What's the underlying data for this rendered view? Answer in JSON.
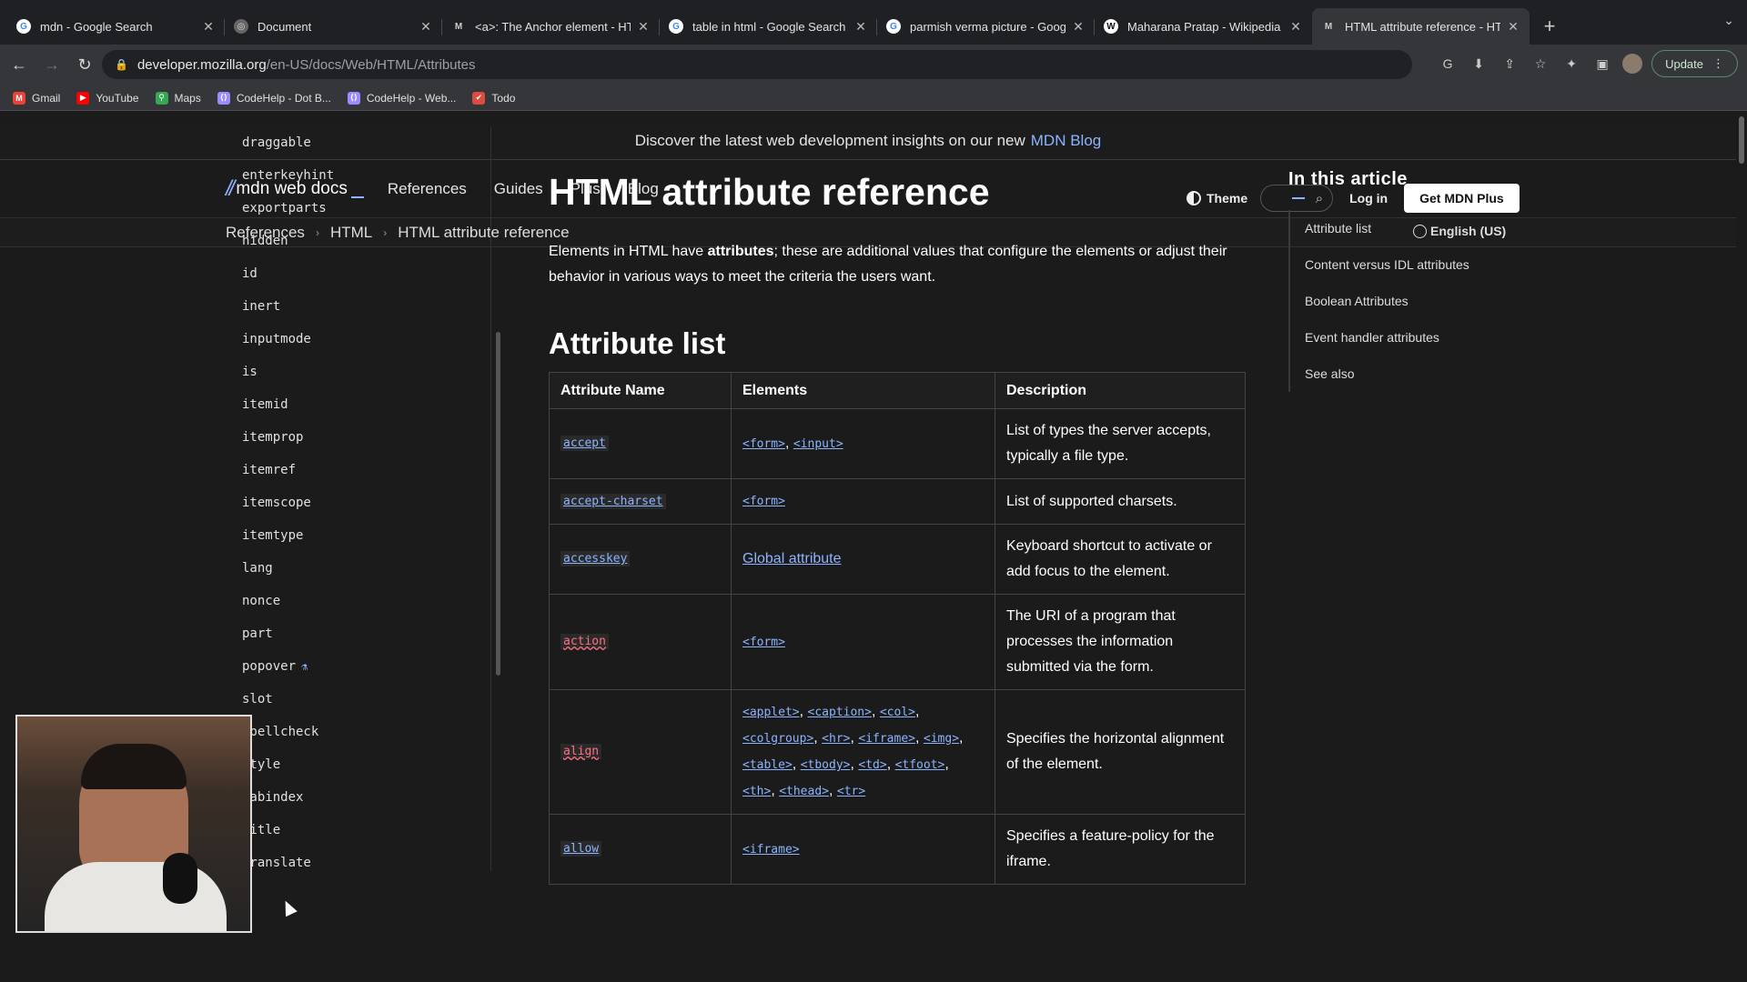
{
  "browser": {
    "tabs": [
      {
        "title": "mdn - Google Search",
        "icon": "google-icon",
        "active": false
      },
      {
        "title": "Document",
        "icon": "globe-icon",
        "active": false
      },
      {
        "title": "<a>: The Anchor element - HT",
        "icon": "mdn-icon",
        "active": false
      },
      {
        "title": "table in html - Google Search",
        "icon": "google-icon",
        "active": false
      },
      {
        "title": "parmish verma picture - Googl",
        "icon": "google-icon",
        "active": false
      },
      {
        "title": "Maharana Pratap - Wikipedia",
        "icon": "wikipedia-icon",
        "active": false
      },
      {
        "title": "HTML attribute reference - HT",
        "icon": "mdn-icon",
        "active": true
      }
    ],
    "url_host": "developer.mozilla.org",
    "url_path": "/en-US/docs/Web/HTML/Attributes",
    "update_label": "Update",
    "bookmarks": [
      {
        "label": "Gmail",
        "color": "#ea4335"
      },
      {
        "label": "YouTube",
        "color": "#ff0000"
      },
      {
        "label": "Maps",
        "color": "#34a853"
      },
      {
        "label": "CodeHelp - Dot B...",
        "color": "#9a8cff"
      },
      {
        "label": "CodeHelp - Web...",
        "color": "#9a8cff"
      },
      {
        "label": "Todo",
        "color": "#db4c3f"
      }
    ]
  },
  "banner": {
    "text": "Discover the latest web development insights on our new",
    "link": "MDN Blog"
  },
  "header": {
    "logo": "mdn web docs",
    "nav": [
      "References",
      "Guides",
      "Plus",
      "Blog"
    ],
    "theme_label": "Theme",
    "login_label": "Log in",
    "cta_label": "Get MDN Plus"
  },
  "breadcrumb": [
    "References",
    "HTML",
    "HTML attribute reference"
  ],
  "language": "English (US)",
  "sidebar": {
    "items": [
      "draggable",
      "enterkeyhint",
      "exportparts",
      "hidden",
      "id",
      "inert",
      "inputmode",
      "is",
      "itemid",
      "itemprop",
      "itemref",
      "itemscope",
      "itemtype",
      "lang",
      "nonce",
      "part",
      "popover",
      "slot",
      "spellcheck",
      "style",
      "tabindex",
      "title",
      "translate"
    ]
  },
  "content": {
    "title": "HTML attribute reference",
    "intro_prefix": "Elements in HTML have",
    "intro_bold": "attributes",
    "intro_suffix": "; these are additional values that configure the elements or adjust their behavior in various ways to meet the criteria the users want.",
    "section_title": "Attribute list",
    "table": {
      "headers": [
        "Attribute Name",
        "Elements",
        "Description"
      ],
      "rows": [
        {
          "name": "accept",
          "elements": [
            "<form>",
            "<input>"
          ],
          "description": "List of types the server accepts, typically a file type."
        },
        {
          "name": "accept-charset",
          "elements": [
            "<form>"
          ],
          "description": "List of supported charsets."
        },
        {
          "name": "accesskey",
          "elements_text": "Global attribute",
          "description": "Keyboard shortcut to activate or add focus to the element."
        },
        {
          "name": "action",
          "deprecated": true,
          "elements": [
            "<form>"
          ],
          "description": "The URI of a program that processes the information submitted via the form."
        },
        {
          "name": "align",
          "deprecated": true,
          "elements": [
            "<applet>",
            "<caption>",
            "<col>",
            "<colgroup>",
            "<hr>",
            "<iframe>",
            "<img>",
            "<table>",
            "<tbody>",
            "<td>",
            "<tfoot>",
            "<th>",
            "<thead>",
            "<tr>"
          ],
          "description": "Specifies the horizontal alignment of the element."
        },
        {
          "name": "allow",
          "elements": [
            "<iframe>"
          ],
          "description": "Specifies a feature-policy for the iframe."
        }
      ]
    }
  },
  "toc": {
    "title": "In this article",
    "items": [
      "Attribute list",
      "Content versus IDL attributes",
      "Boolean Attributes",
      "Event handler attributes",
      "See also"
    ]
  }
}
